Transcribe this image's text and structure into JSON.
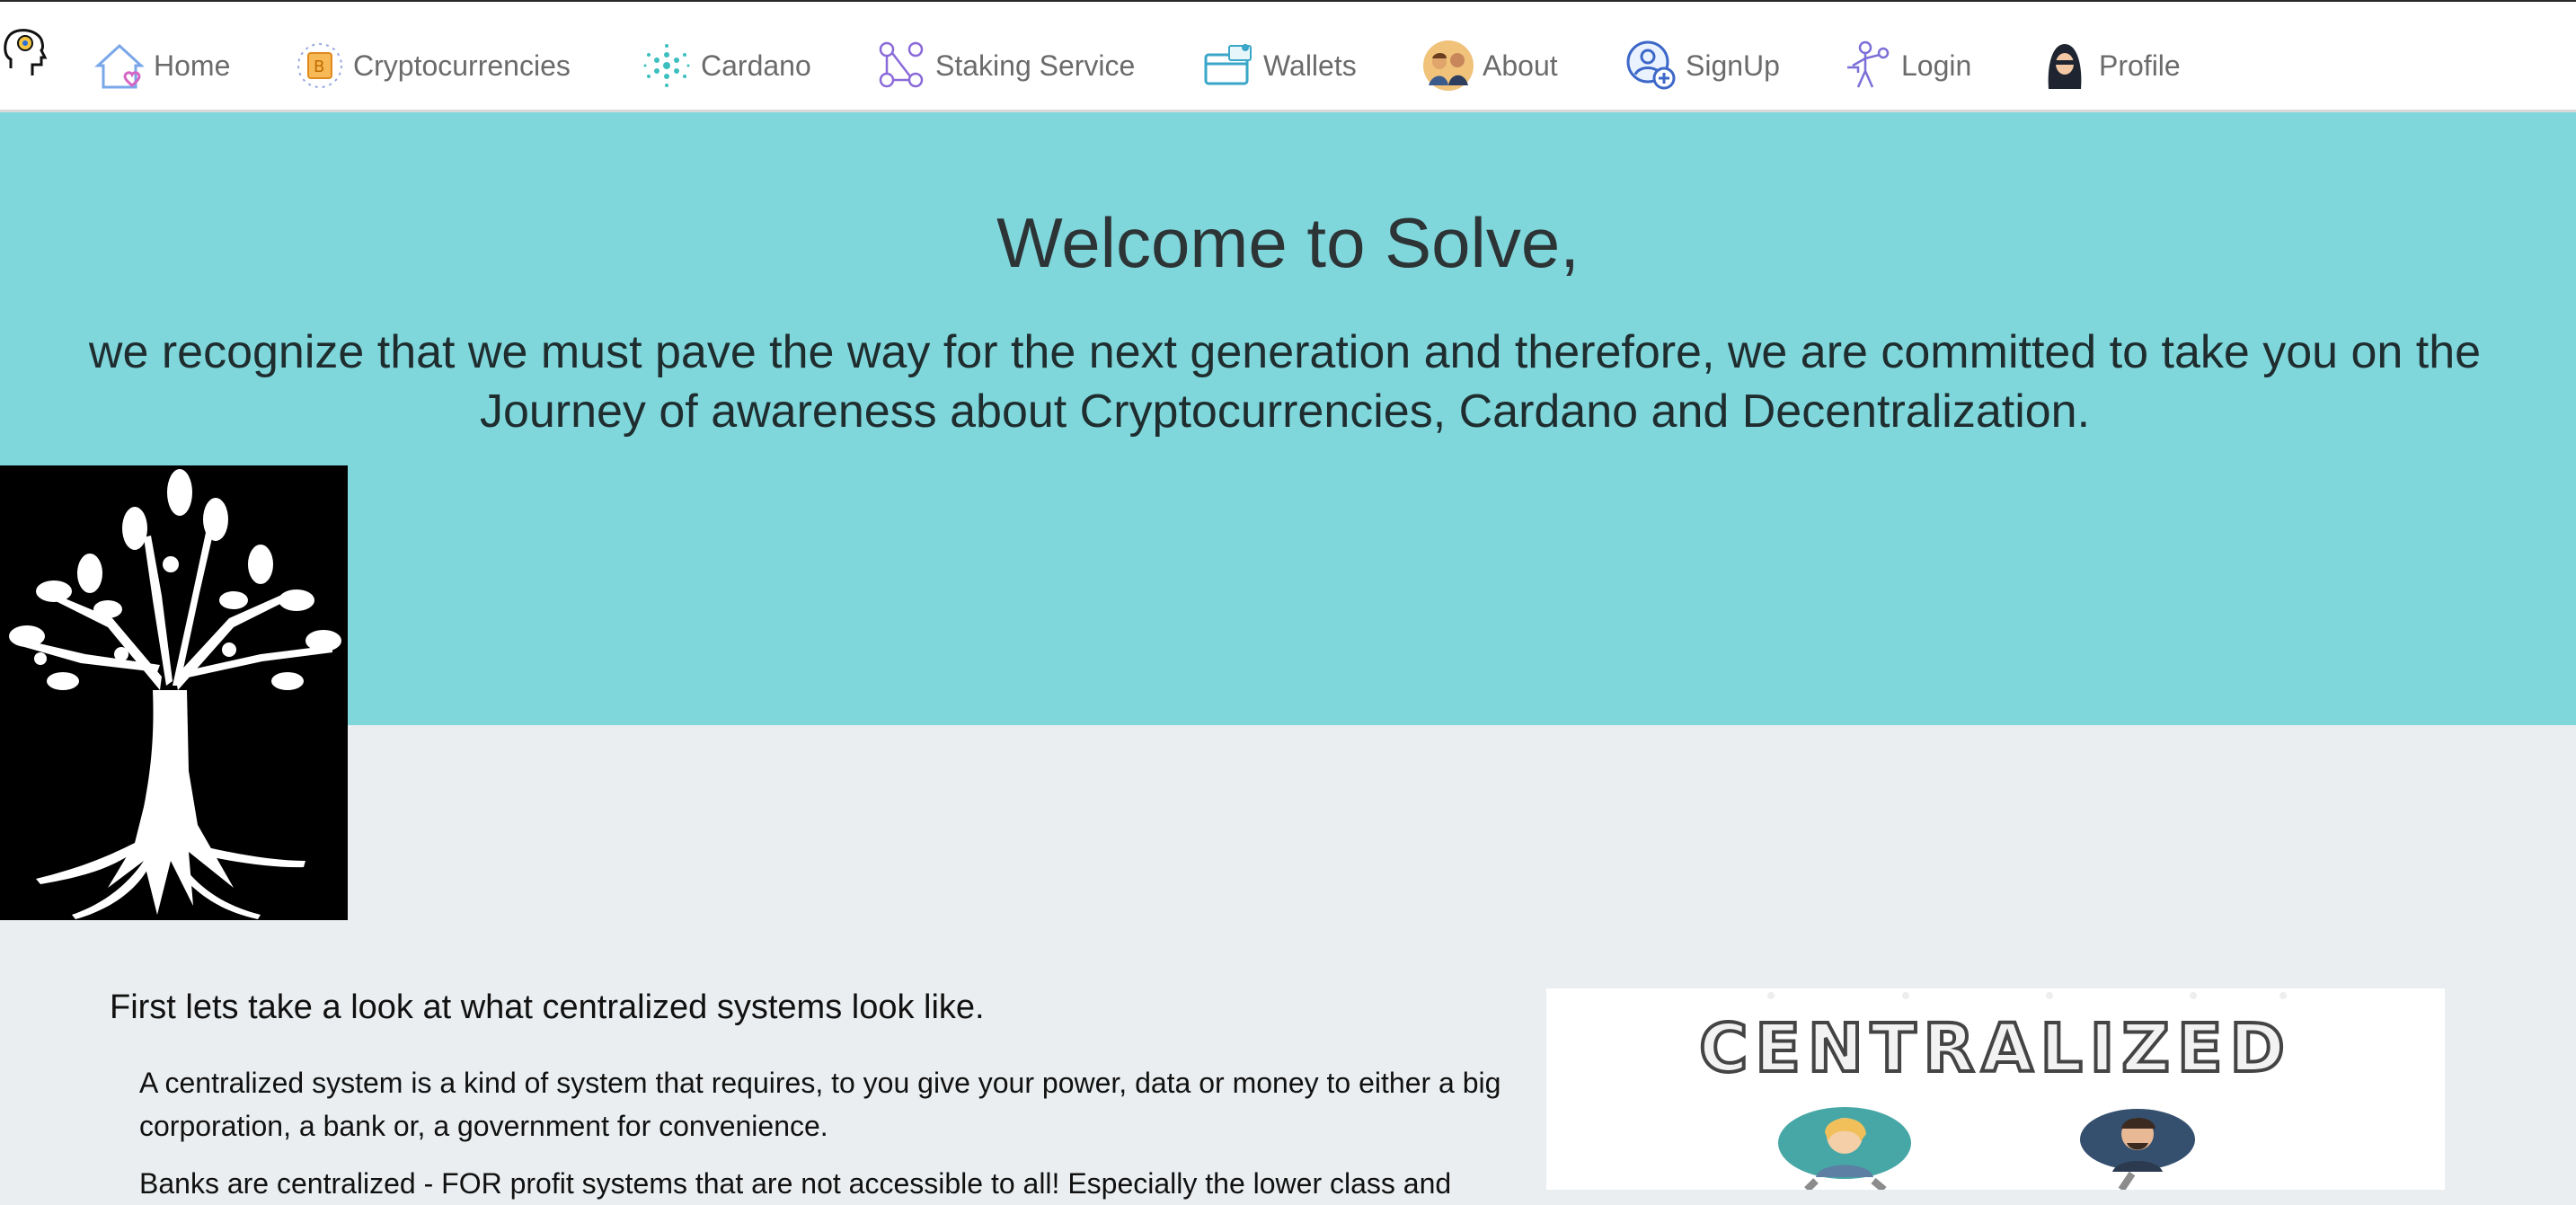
{
  "nav": {
    "items": [
      {
        "label": "Home",
        "icon": "home-heart-icon"
      },
      {
        "label": "Cryptocurrencies",
        "icon": "bitcoin-coin-icon"
      },
      {
        "label": "Cardano",
        "icon": "cardano-logo-icon"
      },
      {
        "label": "Staking Service",
        "icon": "network-users-icon"
      },
      {
        "label": "Wallets",
        "icon": "wallet-card-icon"
      },
      {
        "label": "About",
        "icon": "team-people-icon"
      },
      {
        "label": "SignUp",
        "icon": "user-add-icon"
      },
      {
        "label": "Login",
        "icon": "person-key-icon"
      },
      {
        "label": "Profile",
        "icon": "hooded-user-icon"
      }
    ],
    "brand_icon": "head-gear-icon"
  },
  "hero": {
    "title": "Welcome to Solve,",
    "subtitle": "we recognize that we must pave the way for the next generation and therefore, we are committed to take you on the Journey of awareness about Cryptocurrencies, Cardano and Decentralization.",
    "background": "#7fd7dc"
  },
  "content": {
    "heading": "First lets take a look at what centralized systems look like.",
    "paragraphs": [
      "A centralized system is a kind of system that requires, to you give your power, data or money to either a big corporation, a bank or, a government for convenience.",
      "Banks are centralized - FOR profit systems that are not  accessible to all! Especially the lower class and"
    ],
    "image_title": "CENTRALIZED"
  },
  "colors": {
    "page_bg": "#ebeef0",
    "nav_text": "#6b6b6b",
    "hero_bg": "#7fd7dc"
  }
}
